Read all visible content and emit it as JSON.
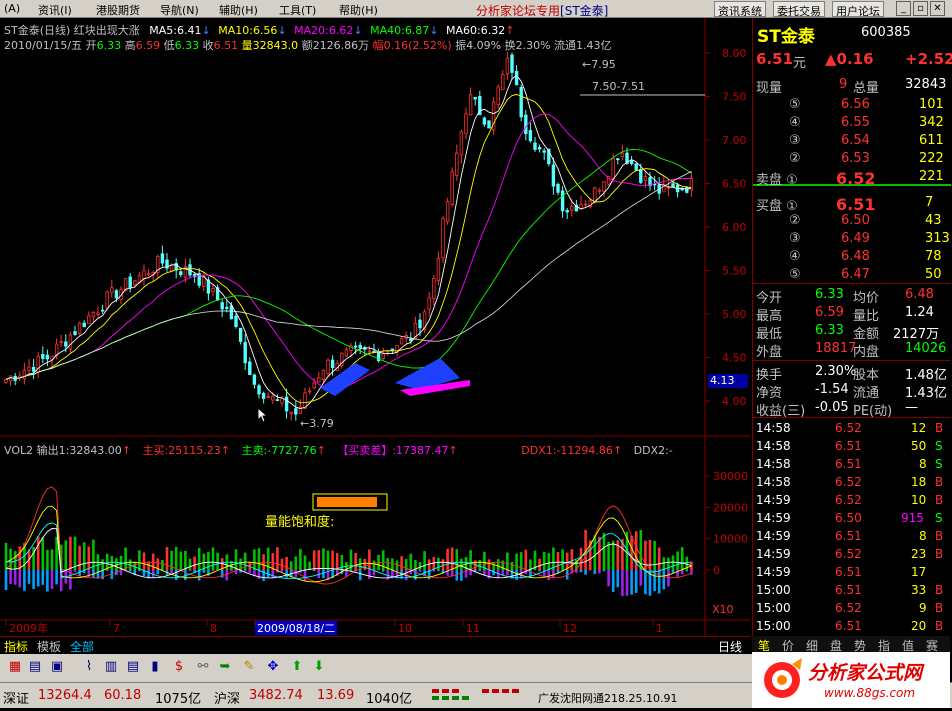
{
  "menu": {
    "items": [
      "(A)",
      "资讯(I)",
      "港股期货",
      "导航(N)",
      "辅助(H)",
      "工具(T)",
      "帮助(H)"
    ],
    "center_title": "分析家论坛专用",
    "center_tab": "[ST金泰]",
    "buttons": [
      "资讯系统",
      "委托交易",
      "用户论坛"
    ]
  },
  "chart": {
    "title": "ST金泰(日线) 红块出现大涨",
    "ma": [
      {
        "label": "MA5:6.41",
        "color": "#ffffff"
      },
      {
        "label": "MA10:6.56",
        "color": "#ffff00"
      },
      {
        "label": "MA20:6.62",
        "color": "#ff00ff"
      },
      {
        "label": "MA40:6.87",
        "color": "#00ff00"
      },
      {
        "label": "MA60:6.32",
        "color": "#ffffff"
      }
    ],
    "info_date": "2010/01/15/五",
    "info_open_l": "开",
    "info_open": "6.33",
    "info_high_l": "高",
    "info_high": "6.59",
    "info_low_l": "低",
    "info_low": "6.33",
    "info_close_l": "收",
    "info_close": "6.51",
    "info_vol": "量32843.0",
    "info_amt": "额2126.86万",
    "info_fu": "幅0.16(2.52%)",
    "info_rest": "振4.09% 换2.30% 流通1.43亿",
    "price_ticks": [
      "8.00",
      "7.50",
      "7.00",
      "6.50",
      "6.00",
      "5.50",
      "5.00",
      "4.50",
      "4.00"
    ],
    "annot_high": "7.95",
    "annot_band": "7.50-7.51",
    "annot_low": "3.79",
    "price_label": "4.13",
    "vol_title": "VOL2 输出1:32843.00",
    "vol_zm": "主买:25115.23",
    "vol_zs": "主卖:-7727.76",
    "vol_mmc": "【买卖差】:17387.47",
    "vol_ddx1": "DDX1:-11294.86",
    "vol_ddx2": "DDX2:-",
    "vol_ticks": [
      "30000",
      "20000",
      "10000",
      "0"
    ],
    "vol_x10": "X10",
    "vol_sat": "量能饱和度:",
    "x_labels": [
      "2009年",
      "7",
      "8",
      "2009/08/18/二",
      "10",
      "11",
      "12",
      "1"
    ],
    "period": "日线",
    "bottom_tabs": [
      "指标",
      "模板",
      "全部"
    ]
  },
  "quote": {
    "name": "ST金泰",
    "code": "600385",
    "price": "6.51",
    "unit": "元",
    "change": "▲0.16",
    "change2": "+2.52",
    "xianliang_l": "现量",
    "xianliang": "9",
    "zongliang_l": "总量",
    "zongliang": "32843",
    "sell": [
      {
        "lvl": "⑤",
        "p": "6.56",
        "v": "101"
      },
      {
        "lvl": "④",
        "p": "6.55",
        "v": "342"
      },
      {
        "lvl": "③",
        "p": "6.54",
        "v": "611"
      },
      {
        "lvl": "②",
        "p": "6.53",
        "v": "222"
      },
      {
        "lvl": "卖盘 ①",
        "p": "6.52",
        "v": "221"
      }
    ],
    "buy": [
      {
        "lvl": "买盘 ①",
        "p": "6.51",
        "v": "7"
      },
      {
        "lvl": "②",
        "p": "6.50",
        "v": "43"
      },
      {
        "lvl": "③",
        "p": "6.49",
        "v": "313"
      },
      {
        "lvl": "④",
        "p": "6.48",
        "v": "78"
      },
      {
        "lvl": "⑤",
        "p": "6.47",
        "v": "50"
      }
    ],
    "stats": [
      {
        "l1": "今开",
        "v1": "6.33",
        "l2": "均价",
        "v2": "6.48",
        "c1": "#00ff00",
        "c2": "#ff3030"
      },
      {
        "l1": "最高",
        "v1": "6.59",
        "l2": "量比",
        "v2": "1.24",
        "c1": "#ff3030",
        "c2": "#ffffff"
      },
      {
        "l1": "最低",
        "v1": "6.33",
        "l2": "金额",
        "v2": "2127万",
        "c1": "#00ff00",
        "c2": "#ffffff"
      },
      {
        "l1": "外盘",
        "v1": "18817",
        "l2": "内盘",
        "v2": "14026",
        "c1": "#ff3030",
        "c2": "#00ff00"
      }
    ],
    "stats2": [
      {
        "l1": "换手",
        "v1": "2.30%",
        "l2": "股本",
        "v2": "1.48亿"
      },
      {
        "l1": "净资",
        "v1": "-1.54",
        "l2": "流通",
        "v2": "1.43亿"
      },
      {
        "l1": "收益(三)",
        "v1": "-0.05",
        "l2": "PE(动)",
        "v2": "—"
      }
    ],
    "ticks": [
      {
        "t": "14:58",
        "p": "6.52",
        "v": "12",
        "s": "B",
        "pc": "#ff3030",
        "sc": "#ff3030"
      },
      {
        "t": "14:58",
        "p": "6.51",
        "v": "50",
        "s": "S",
        "pc": "#ff3030",
        "sc": "#00ff00"
      },
      {
        "t": "14:58",
        "p": "6.51",
        "v": "8",
        "s": "S",
        "pc": "#ff3030",
        "sc": "#00ff00"
      },
      {
        "t": "14:58",
        "p": "6.52",
        "v": "18",
        "s": "B",
        "pc": "#ff3030",
        "sc": "#ff3030"
      },
      {
        "t": "14:59",
        "p": "6.52",
        "v": "10",
        "s": "B",
        "pc": "#ff3030",
        "sc": "#ff3030"
      },
      {
        "t": "14:59",
        "p": "6.50",
        "v": "915",
        "s": "S",
        "pc": "#ff3030",
        "sc": "#00ff00",
        "vc": "#ff00ff"
      },
      {
        "t": "14:59",
        "p": "6.51",
        "v": "8",
        "s": "B",
        "pc": "#ff3030",
        "sc": "#ff3030"
      },
      {
        "t": "14:59",
        "p": "6.52",
        "v": "23",
        "s": "B",
        "pc": "#ff3030",
        "sc": "#ff3030"
      },
      {
        "t": "14:59",
        "p": "6.51",
        "v": "17",
        "s": "",
        "pc": "#ff3030",
        "sc": "#ff3030"
      },
      {
        "t": "15:00",
        "p": "6.51",
        "v": "33",
        "s": "B",
        "pc": "#ff3030",
        "sc": "#ff3030"
      },
      {
        "t": "15:00",
        "p": "6.52",
        "v": "9",
        "s": "B",
        "pc": "#ff3030",
        "sc": "#ff3030"
      },
      {
        "t": "15:00",
        "p": "6.51",
        "v": "20",
        "s": "B",
        "pc": "#ff3030",
        "sc": "#ff3030"
      }
    ],
    "side_tabs": [
      "笔",
      "价",
      "细",
      "盘",
      "势",
      "指",
      "值",
      "赛"
    ]
  },
  "status": {
    "sz_l": "深证",
    "sz": "13264.4",
    "sz_c": "60.18",
    "sz_a": "1075亿",
    "hs_l": "沪深",
    "hs": "3482.74",
    "hs_c": "13.69",
    "hs_a": "1040亿",
    "net": "广发沈阳网通218.25.10.91"
  },
  "logo": {
    "text": "分析家公式网",
    "url": "www.88gs.com"
  }
}
